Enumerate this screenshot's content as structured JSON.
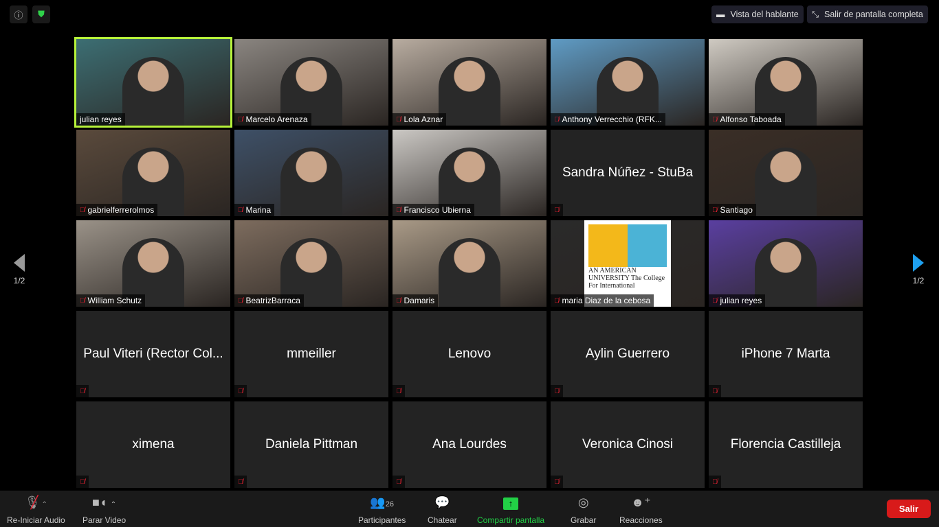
{
  "top": {
    "info_icon": "info-icon",
    "shield_icon": "shield-icon",
    "speaker_view": "Vista del hablante",
    "exit_fullscreen": "Salir de pantalla completa"
  },
  "pagination": {
    "left": "1/2",
    "right": "1/2",
    "right_arrow_color": "#1ea0f0"
  },
  "participants": [
    {
      "name": "julian reyes",
      "video": true,
      "active": true,
      "muted": false,
      "bg": "#3c6e73"
    },
    {
      "name": "Marcelo Arenaza",
      "video": true,
      "muted": true,
      "bg": "#8a8580"
    },
    {
      "name": "Lola Aznar",
      "video": true,
      "muted": true,
      "bg": "#b8aca0"
    },
    {
      "name": "Anthony Verrecchio (RFK...",
      "video": true,
      "muted": true,
      "bg": "#5f9bc4"
    },
    {
      "name": "Alfonso Taboada",
      "video": true,
      "muted": true,
      "bg": "#cfcac2"
    },
    {
      "name": "gabrielferrerolmos",
      "video": true,
      "muted": true,
      "bg": "#5a4a3c"
    },
    {
      "name": "Marina",
      "video": true,
      "muted": true,
      "bg": "#3e5067"
    },
    {
      "name": "Francisco Ubierna",
      "video": true,
      "muted": true,
      "bg": "#cbc8c4"
    },
    {
      "name": "Sandra Núñez - StuBa",
      "video": false,
      "muted": true,
      "show_label": false
    },
    {
      "name": "Santiago",
      "video": true,
      "muted": true,
      "bg": "#3a2e26"
    },
    {
      "name": "William Schutz",
      "video": true,
      "muted": true,
      "bg": "#9a9288"
    },
    {
      "name": "BeatrizBarraca",
      "video": true,
      "muted": true,
      "bg": "#7d6c5e"
    },
    {
      "name": "Damaris",
      "video": true,
      "muted": true,
      "bg": "#a99a87"
    },
    {
      "name": "maria Diaz de la cebosa",
      "video": true,
      "muted": true,
      "bg": "#2a2a2a",
      "logo_text": "AN AMERICAN UNIVERSITY The College For International"
    },
    {
      "name": "julian reyes",
      "video": true,
      "muted": true,
      "bg": "#5a3fa0"
    },
    {
      "name": "Paul Viteri (Rector Col...",
      "video": false,
      "muted": true
    },
    {
      "name": "mmeiller",
      "video": false,
      "muted": true
    },
    {
      "name": "Lenovo",
      "video": false,
      "muted": true
    },
    {
      "name": "Aylin Guerrero",
      "video": false,
      "muted": true
    },
    {
      "name": "iPhone 7 Marta",
      "video": false,
      "muted": true
    },
    {
      "name": "ximena",
      "video": false,
      "muted": true
    },
    {
      "name": "Daniela Pittman",
      "video": false,
      "muted": true
    },
    {
      "name": "Ana Lourdes",
      "video": false,
      "muted": true
    },
    {
      "name": "Veronica Cinosi",
      "video": false,
      "muted": true
    },
    {
      "name": "Florencia Castilleja",
      "video": false,
      "muted": true
    }
  ],
  "toolbar": {
    "audio": "Re-Iniciar Audio",
    "video": "Parar Video",
    "participants": "Participantes",
    "participant_count": "26",
    "chat": "Chatear",
    "share": "Compartir pantalla",
    "share_color": "#22d046",
    "record": "Grabar",
    "reactions": "Reacciones",
    "leave": "Salir",
    "leave_color": "#d81a1a"
  }
}
